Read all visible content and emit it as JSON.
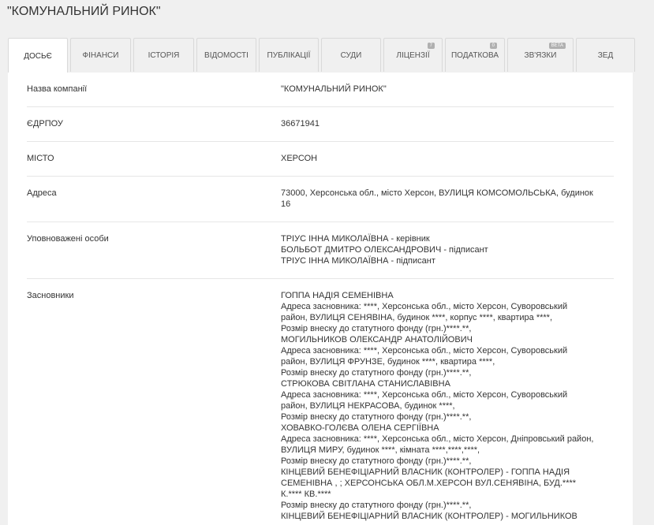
{
  "page": {
    "title": "\"КОМУНАЛЬНИЙ РИНОК\""
  },
  "tabs": [
    {
      "label": "ДОСЬЄ",
      "active": true,
      "badge": null
    },
    {
      "label": "ФІНАНСИ",
      "badge": null
    },
    {
      "label": "ІСТОРІЯ",
      "badge": null
    },
    {
      "label": "ВІДОМОСТІ",
      "badge": null
    },
    {
      "label": "ПУБЛІКАЦІЇ",
      "badge": null
    },
    {
      "label": "СУДИ",
      "badge": null
    },
    {
      "label": "ЛІЦЕНЗІЇ",
      "badge": "7"
    },
    {
      "label": "ПОДАТКОВА",
      "badge": "0"
    },
    {
      "label": "ЗВ'ЯЗКИ",
      "badge": "Beta"
    },
    {
      "label": "ЗЕД",
      "badge": null
    }
  ],
  "details": {
    "company_name": {
      "label": "Назва компанії",
      "value": "\"КОМУНАЛЬНИЙ РИНОК\""
    },
    "edrpou": {
      "label": "ЄДРПОУ",
      "value": "36671941"
    },
    "city": {
      "label": "МІСТО",
      "value": "ХЕРСОН"
    },
    "address": {
      "label": "Адреса",
      "value_line1": "73000, Херсонська обл., місто Херсон, ВУЛИЦЯ КОМСОМОЛЬСЬКА, будинок",
      "value_line2": "16"
    },
    "authorized": {
      "label": "Уповноважені особи",
      "persons": [
        "ТРІУС ІННА МИКОЛАЇВНА - керівник",
        "БОЛЬБОТ ДМИТРО ОЛЕКСАНДРОВИЧ - підписант",
        "ТРІУС ІННА МИКОЛАЇВНА - підписант"
      ]
    },
    "founders": {
      "label": "Засновники",
      "lines": [
        "ГОППА НАДІЯ СЕМЕНІВНА",
        "Адреса засновника: ****, Херсонська обл., місто Херсон, Суворовський",
        "район, ВУЛИЦЯ СЕНЯВІНА, будинок ****, корпус ****, квартира ****,",
        "Розмір внеску до статутного фонду (грн.)****.**,",
        "МОГИЛЬНИКОВ ОЛЕКСАНДР АНАТОЛІЙОВИЧ",
        "Адреса засновника: ****, Херсонська обл., місто Херсон, Суворовський",
        "район, ВУЛИЦЯ ФРУНЗЕ, будинок ****, квартира ****,",
        "Розмір внеску до статутного фонду (грн.)****.**,",
        "СТРЮКОВА СВІТЛАНА СТАНИСЛАВІВНА",
        "Адреса засновника: ****, Херсонська обл., місто Херсон, Суворовський",
        "район, ВУЛИЦЯ НЕКРАСОВА, будинок ****,",
        "Розмір внеску до статутного фонду (грн.)****.**,",
        "ХОВАВКО-ГОЛЄВА ОЛЕНА СЕРГІЇВНА",
        "Адреса засновника: ****, Херсонська обл., місто Херсон, Дніпровський район,",
        "ВУЛИЦЯ МИРУ, будинок ****, кімната ****,****,****,",
        "Розмір внеску до статутного фонду (грн.)****.**,",
        "КІНЦЕВИЙ БЕНЕФІЦІАРНИЙ ВЛАСНИК (КОНТРОЛЕР) - ГОППА НАДІЯ",
        "СЕМЕНІВНА , ; ХЕРСОНСЬКА ОБЛ.М.ХЕРСОН ВУЛ.СЕНЯВІНА, БУД.****",
        "К.**** КВ.****",
        "Розмір внеску до статутного фонду (грн.)****.**,",
        "КІНЦЕВИЙ БЕНЕФІЦІАРНИЙ ВЛАСНИК (КОНТРОЛЕР) - МОГИЛЬНИКОВ"
      ]
    }
  }
}
